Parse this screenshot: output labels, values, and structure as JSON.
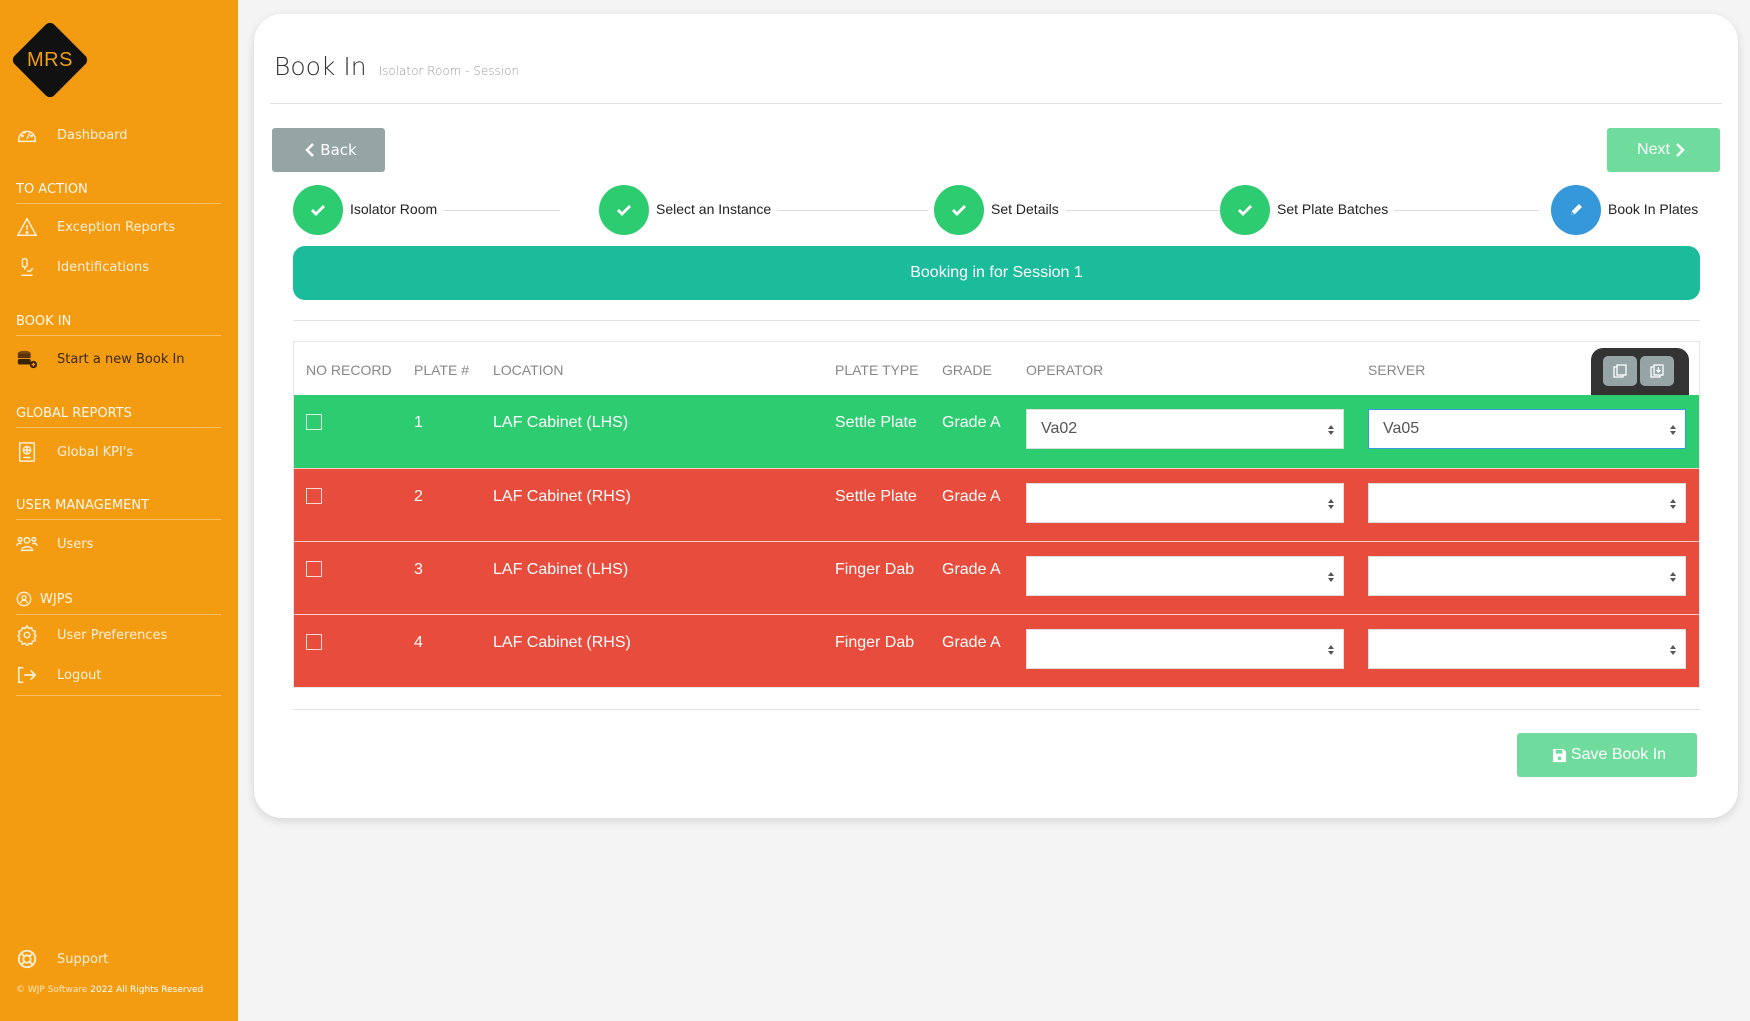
{
  "sidebar": {
    "logo_text": "MRS",
    "dashboard": "Dashboard",
    "sections": {
      "to_action": "TO ACTION",
      "book_in": "BOOK IN",
      "global_reports": "GLOBAL REPORTS",
      "user_management": "USER MANAGEMENT",
      "wjps": "WJPS"
    },
    "items": {
      "exception_reports": "Exception Reports",
      "identifications": "Identifications",
      "start_book_in": "Start a new Book In",
      "global_kpis": "Global KPI's",
      "users": "Users",
      "user_preferences": "User Preferences",
      "logout": "Logout",
      "support": "Support"
    },
    "footer": {
      "copyright": "© WJP Software",
      "year_rights": "2022 All Rights Reserved"
    }
  },
  "header": {
    "title": "Book In",
    "subtitle": "Isolator Room - Session"
  },
  "nav": {
    "back_label": "Back",
    "next_label": "Next"
  },
  "stepper": {
    "steps": [
      {
        "label": "Isolator Room",
        "state": "complete"
      },
      {
        "label": "Select an Instance",
        "state": "complete"
      },
      {
        "label": "Set Details",
        "state": "complete"
      },
      {
        "label": "Set Plate Batches",
        "state": "complete"
      },
      {
        "label": "Book In Plates",
        "state": "active"
      }
    ]
  },
  "banner": {
    "text": "Booking in for Session 1"
  },
  "table": {
    "headers": {
      "no_record": "NO RECORD",
      "plate": "PLATE #",
      "location": "LOCATION",
      "plate_type": "PLATE TYPE",
      "grade": "GRADE",
      "operator": "OPERATOR",
      "server": "SERVER"
    },
    "toolbar": {
      "copy_icon": "copy-icon",
      "paste_icon": "paste-down-icon"
    },
    "rows": [
      {
        "plate": "1",
        "location": "LAF Cabinet (LHS)",
        "plate_type": "Settle Plate",
        "grade": "Grade A",
        "operator": "Va02",
        "server": "Va05",
        "status": "complete",
        "no_record": false
      },
      {
        "plate": "2",
        "location": "LAF Cabinet (RHS)",
        "plate_type": "Settle Plate",
        "grade": "Grade A",
        "operator": "",
        "server": "",
        "status": "incomplete",
        "no_record": false
      },
      {
        "plate": "3",
        "location": "LAF Cabinet (LHS)",
        "plate_type": "Finger Dab",
        "grade": "Grade A",
        "operator": "",
        "server": "",
        "status": "incomplete",
        "no_record": false
      },
      {
        "plate": "4",
        "location": "LAF Cabinet (RHS)",
        "plate_type": "Finger Dab",
        "grade": "Grade A",
        "operator": "",
        "server": "",
        "status": "incomplete",
        "no_record": false
      }
    ]
  },
  "actions": {
    "save_label": "Save Book In"
  },
  "colors": {
    "sidebar": "#F39C12",
    "complete": "#2ECC71",
    "incomplete": "#E74C3C",
    "active_step": "#3498DB",
    "banner": "#1ABC9C",
    "next_save": "#6FDB9C",
    "back": "#95A5A6"
  }
}
